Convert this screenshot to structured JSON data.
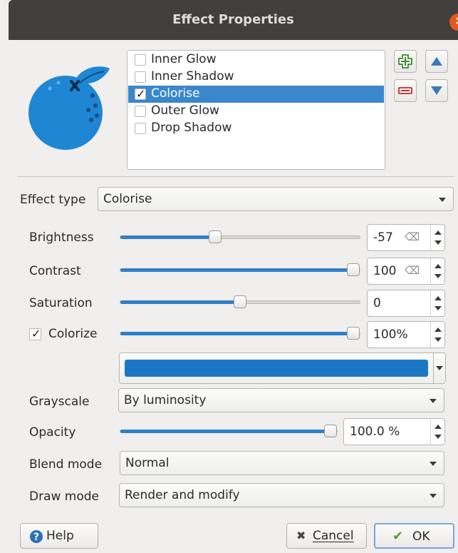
{
  "window": {
    "title": "Effect Properties",
    "close_icon": "close-icon"
  },
  "preview": {
    "icon": "orange-fruit-preview-icon",
    "color": "#1f86d3"
  },
  "effects": {
    "items": [
      {
        "label": "Inner Glow",
        "checked": false,
        "selected": false
      },
      {
        "label": "Inner Shadow",
        "checked": false,
        "selected": false
      },
      {
        "label": "Colorise",
        "checked": true,
        "selected": true
      },
      {
        "label": "Outer Glow",
        "checked": false,
        "selected": false
      },
      {
        "label": "Drop Shadow",
        "checked": false,
        "selected": false
      }
    ],
    "buttons": {
      "add_icon": "plus-icon",
      "remove_icon": "minus-icon",
      "up_icon": "arrow-up-icon",
      "down_icon": "arrow-down-icon"
    }
  },
  "effect_type": {
    "label": "Effect type",
    "value": "Colorise"
  },
  "brightness": {
    "label": "Brightness",
    "value": "-57",
    "slider_fraction": 0.39
  },
  "contrast": {
    "label": "Contrast",
    "value": "100",
    "slider_fraction": 1.0
  },
  "saturation": {
    "label": "Saturation",
    "value": "0",
    "slider_fraction": 0.5
  },
  "colorize": {
    "label": "Colorize",
    "checked": true,
    "value": "100%",
    "slider_fraction": 1.0
  },
  "color": {
    "swatch": "#1b77c4"
  },
  "grayscale": {
    "label": "Grayscale",
    "value": "By luminosity"
  },
  "opacity": {
    "label": "Opacity",
    "value": "100.0 %",
    "slider_fraction": 1.0
  },
  "blend_mode": {
    "label": "Blend mode",
    "value": "Normal"
  },
  "draw_mode": {
    "label": "Draw mode",
    "value": "Render and modify"
  },
  "footer": {
    "help": "Help",
    "cancel": "Cancel",
    "ok": "OK"
  },
  "colors": {
    "accent": "#3a87cc",
    "titlebar": "#403f3b",
    "close": "#e2571e"
  }
}
